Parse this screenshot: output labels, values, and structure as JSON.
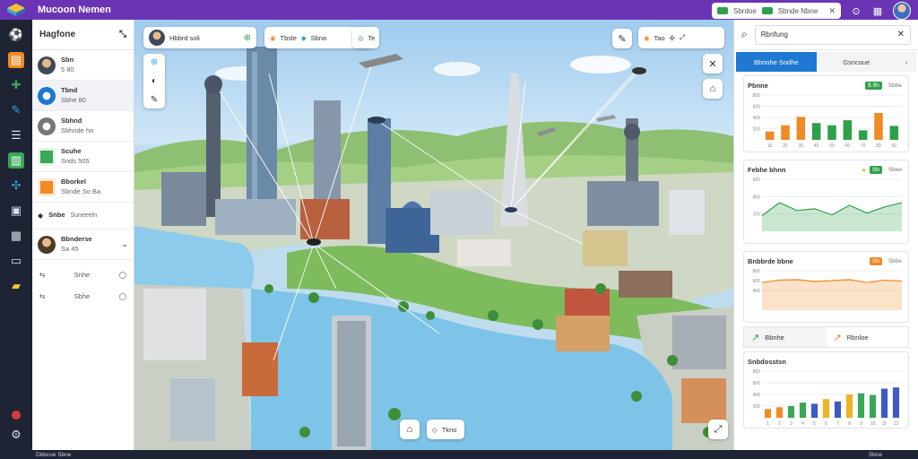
{
  "app": {
    "title": "Mucoon Nemen"
  },
  "topbar": {
    "search_text": "Sbrdoe",
    "chip_text": "Sbnde Nbne"
  },
  "left_panel": {
    "title": "Hagfone",
    "items": [
      {
        "title": "Sbn",
        "sub": "5 80"
      },
      {
        "title": "Tbnd",
        "sub": "Sbhe 80"
      },
      {
        "title": "Sbhnd",
        "sub": "Sbhnde ho"
      },
      {
        "title": "Scuhe",
        "sub": "Snds 505"
      },
      {
        "title": "Bborkel",
        "sub": "Sbnde So Ba"
      },
      {
        "title": "Snbe",
        "sub": "Suneeeln"
      },
      {
        "title": "Bbnderse",
        "sub": "Sa 45"
      }
    ],
    "small_items": [
      "Snhe",
      "Sbhe"
    ]
  },
  "map": {
    "chip_main": "Hbbrd soli",
    "chip_b1": "Tbsle",
    "chip_b2": "Sbno",
    "chip_b3": "Te",
    "chip_right": "Tao",
    "bottom_chip": "Tkno"
  },
  "right_panel": {
    "search_text": "Rbnfung",
    "tabs": [
      "Bbnnhe Sodhe",
      "Gsncoue"
    ],
    "card1": {
      "title": "Pbnne",
      "tag1": "$ 8h",
      "tag2": "Sbbe"
    },
    "card2": {
      "title": "Febhe bhnn",
      "tag1": "Sb",
      "tag2": "Sbee"
    },
    "card3": {
      "title": "Bnbbrde bbne",
      "tag1": "Sb",
      "tag2": "Sbbe"
    },
    "half_tabs": [
      "Bbnhe",
      "Rbnloe"
    ],
    "card4": {
      "title": "Snbdosstsn"
    }
  },
  "status": {
    "left": "Dbbcoe Sbne",
    "right": "Sbne"
  },
  "chart_data": [
    {
      "type": "bar",
      "title": "Pbnne",
      "yticks": [
        800,
        600,
        400,
        200
      ],
      "categories": [
        "10",
        "20",
        "30",
        "40",
        "50",
        "60",
        "70",
        "80",
        "90"
      ],
      "values": [
        150,
        260,
        410,
        300,
        260,
        350,
        170,
        480,
        250
      ],
      "colors": [
        "#f08a24",
        "#f08a24",
        "#f08a24",
        "#2fa04a",
        "#2fa04a",
        "#2fa04a",
        "#2fa04a",
        "#f08a24",
        "#2fa04a"
      ]
    },
    {
      "type": "area",
      "title": "Febhe bhnn",
      "yticks": [
        600,
        400,
        200
      ],
      "x": [
        0,
        1,
        2,
        3,
        4,
        5,
        6,
        7,
        8
      ],
      "values": [
        180,
        330,
        240,
        260,
        190,
        300,
        210,
        280,
        330
      ],
      "color": "#2fa04a"
    },
    {
      "type": "area",
      "title": "Bnbbrde bbne",
      "yticks": [
        800,
        600,
        400
      ],
      "x": [
        0,
        1,
        2,
        3,
        4,
        5,
        6,
        7,
        8
      ],
      "values": [
        560,
        610,
        620,
        580,
        600,
        620,
        560,
        610,
        590
      ],
      "color": "#f08a24"
    },
    {
      "type": "bar",
      "title": "Snbdosstsn",
      "yticks": [
        800,
        600,
        400,
        200
      ],
      "categories": [
        "1",
        "2",
        "3",
        "4",
        "5",
        "6",
        "7",
        "8",
        "9",
        "10",
        "11",
        "12"
      ],
      "values": [
        150,
        180,
        200,
        260,
        240,
        320,
        280,
        400,
        420,
        390,
        500,
        520
      ],
      "colors": [
        "#f08a24",
        "#f08a24",
        "#3aa657",
        "#3aa657",
        "#3b5cc4",
        "#f0b323",
        "#3b5cc4",
        "#f0b323",
        "#3aa657",
        "#3aa657",
        "#3b5cc4",
        "#3b5cc4"
      ]
    }
  ]
}
